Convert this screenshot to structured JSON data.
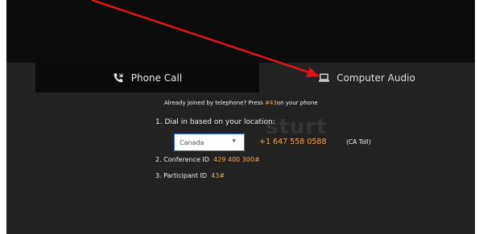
{
  "tabs": {
    "phone_call": "Phone Call",
    "computer_audio": "Computer Audio"
  },
  "watermark": "sturt",
  "instructions": {
    "already_prefix": "Already joined by telephone? Press ",
    "already_code": "#43",
    "already_suffix": "on your phone",
    "step1": "1. Dial in based on your location:",
    "country_selected": "Canada",
    "phone_number": "+1 647 558 0588",
    "toll_label": "(CA Toll)",
    "step2_label": "2. Conference ID",
    "conference_id": "429 400 300#",
    "step3_label": "3. Participant ID",
    "participant_id": "43#"
  },
  "icons": {
    "phone": "phone-icon",
    "computer": "laptop-icon",
    "annotation": "red-arrow"
  },
  "colors": {
    "accent": "#f0a64a",
    "annotation_arrow": "#e11414",
    "select_border": "#3b6fd6"
  }
}
